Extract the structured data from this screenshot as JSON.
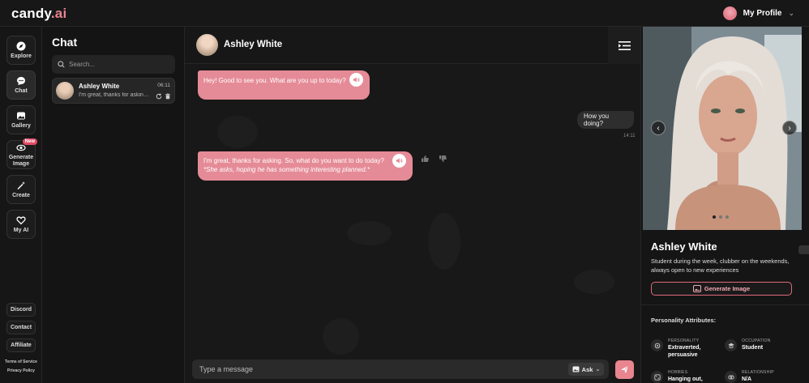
{
  "brand": {
    "name": "candy",
    "suffix": ".ai"
  },
  "header": {
    "profile_label": "My Profile"
  },
  "nav": {
    "items": [
      {
        "label": "Explore"
      },
      {
        "label": "Chat"
      },
      {
        "label": "Gallery"
      },
      {
        "label": "Generate Image",
        "badge": "New"
      },
      {
        "label": "Create"
      },
      {
        "label": "My AI"
      }
    ],
    "bottom": [
      "Discord",
      "Contact",
      "Affiliate"
    ],
    "links": [
      "Terms of Service",
      "Privacy Policy"
    ]
  },
  "chatlist": {
    "title": "Chat",
    "search_placeholder": "Search...",
    "conversations": [
      {
        "name": "Ashley White",
        "time": "06:11",
        "preview": "I'm great, thanks for asking. So, what do you want to do today?"
      }
    ]
  },
  "chat": {
    "name": "Ashley White",
    "messages": [
      {
        "text": "Hey! Good to see you. What are you up to today?"
      },
      {
        "text": "How you doing?",
        "time": "14:11"
      },
      {
        "text": "I'm great, thanks for asking. So, what do you want to do today?",
        "italic": "*She asks, hoping he has something interesting planned.*"
      }
    ],
    "input_placeholder": "Type a message",
    "ask_label": "Ask"
  },
  "profile": {
    "name": "Ashley White",
    "bio": "Student during the week, clubber on the weekends, always open to new experiences",
    "generate_label": "Generate Image",
    "attributes_title": "Personality Attributes:",
    "attributes": [
      {
        "key": "PERSONALITY",
        "value": "Extraverted, persuasive"
      },
      {
        "key": "OCCUPATION",
        "value": "Student"
      },
      {
        "key": "HOBBIES",
        "value": "Hanging out,"
      },
      {
        "key": "RELATIONSHIP",
        "value": "N/A"
      }
    ]
  },
  "colors": {
    "accent": "#e58b97",
    "background": "#121212"
  }
}
